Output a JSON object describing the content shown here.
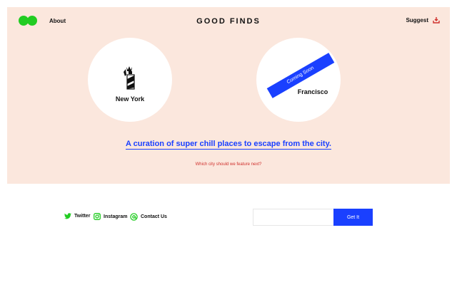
{
  "header": {
    "about_label": "About",
    "brand_title": "GOOD FINDS",
    "suggest_label": "Suggest"
  },
  "cities": [
    {
      "name": "New York",
      "icon": "statue-of-liberty-icon"
    },
    {
      "name": "Francisco",
      "icon": "",
      "ribbon": "Coming Soon"
    }
  ],
  "hero": {
    "tagline": "A curation of super chill places to escape from the city.",
    "question": "Which city should we feature next?"
  },
  "footer": {
    "social": [
      {
        "label": "Twitter",
        "icon": "twitter-icon"
      },
      {
        "label": "Instagram",
        "icon": "instagram-icon"
      },
      {
        "label": "Contact Us",
        "icon": "at-sign-icon"
      }
    ],
    "input_value": "",
    "input_placeholder": "",
    "button_label": "Get It"
  },
  "colors": {
    "hero_bg": "#fbe7dd",
    "accent_blue": "#1a40ff",
    "brand_green": "#22cc22",
    "alert_red": "#d0312d"
  }
}
